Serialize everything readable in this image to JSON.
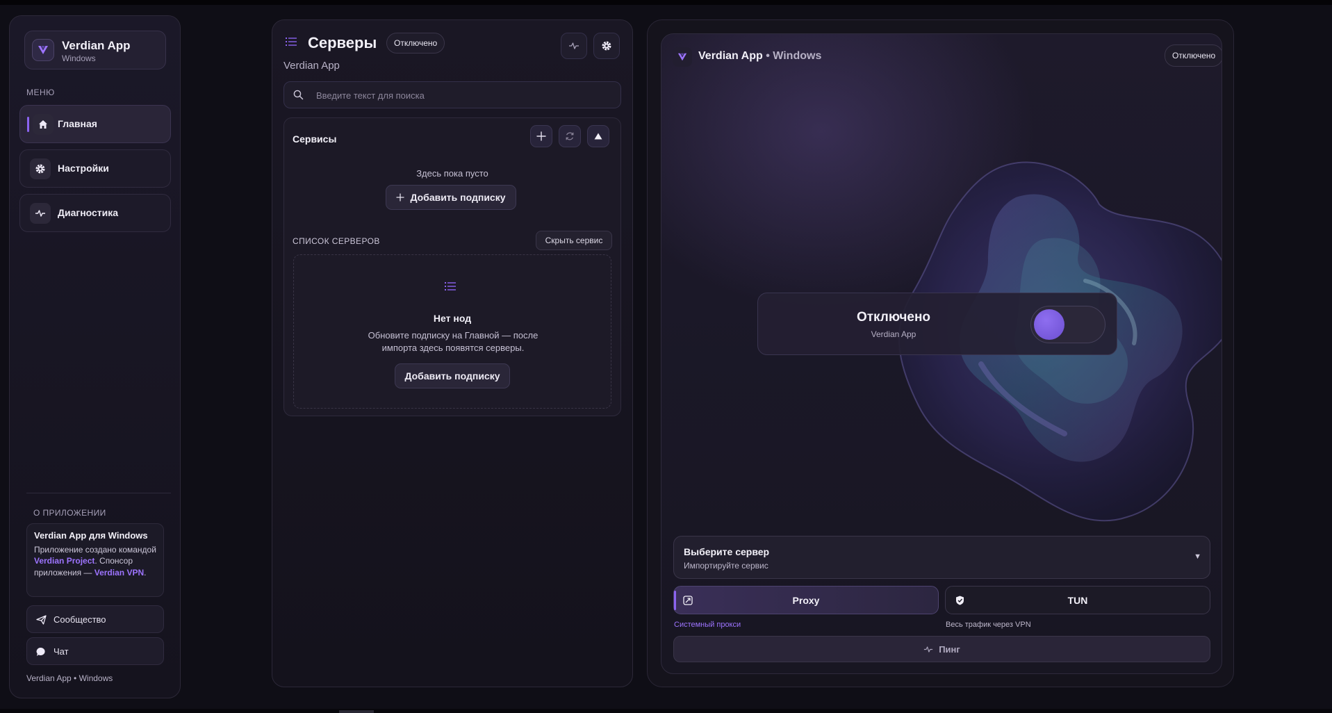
{
  "sidebar": {
    "brand_name": "Verdian App",
    "brand_sub": "Windows",
    "menu_label": "МЕНЮ",
    "items": [
      {
        "label": "Главная",
        "icon": "home-icon",
        "active": true
      },
      {
        "label": "Настройки",
        "icon": "gear-icon",
        "active": false
      },
      {
        "label": "Диагностика",
        "icon": "pulse-icon",
        "active": false
      }
    ],
    "about_label": "О ПРИЛОЖЕНИИ",
    "about_title": "Verdian App для Windows",
    "about_text_1": "Приложение создано командой ",
    "about_link_1": "Verdian Project",
    "about_text_2": ". Спонсор приложения — ",
    "about_link_2": "Verdian VPN",
    "about_text_3": ".",
    "community_label": "Сообщество",
    "chat_label": "Чат",
    "footer": "Verdian App • Windows"
  },
  "servers": {
    "title": "Серверы",
    "status": "Отключено",
    "subtitle": "Verdian App",
    "search_placeholder": "Введите текст для поиска",
    "services_title": "Сервисы",
    "empty_text": "Здесь пока пусто",
    "add_subscription": "Добавить подписку",
    "list_label": "СПИСОК СЕРВЕРОВ",
    "hide_service": "Скрыть сервис",
    "no_nodes_title": "Нет нод",
    "no_nodes_text": "Обновите подписку на Главной — после импорта здесь появятся серверы.",
    "add_subscription_2": "Добавить подписку"
  },
  "main": {
    "title_app": "Verdian App",
    "title_sep": " • ",
    "title_platform": "Windows",
    "status": "Отключено",
    "connection_status": "Отключено",
    "connection_sub": "Verdian App",
    "toggle_on": false,
    "server_select_title": "Выберите сервер",
    "server_select_sub": "Импортируйте сервис",
    "modes": [
      {
        "label": "Proxy",
        "hint": "Системный прокси",
        "active": true
      },
      {
        "label": "TUN",
        "hint": "Весь трафик через VPN",
        "active": false
      }
    ],
    "ping_label": "Пинг"
  },
  "colors": {
    "accent": "#8b63f0",
    "accent_text": "#9d74ff",
    "background": "#0f0e16",
    "panel": "#1a1724"
  }
}
